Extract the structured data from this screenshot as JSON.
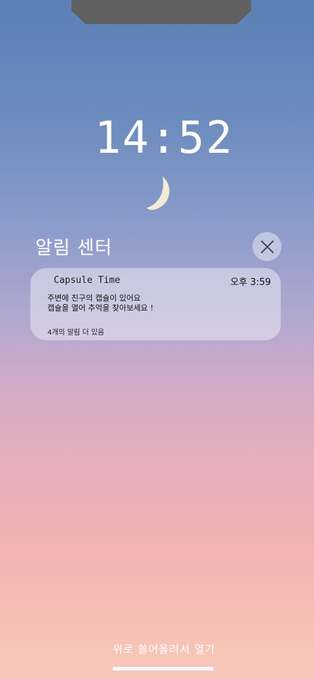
{
  "lockscreen": {
    "time": "14:52",
    "moon_icon": "crescent-moon-icon"
  },
  "notification_center": {
    "title": "알림 센터",
    "close_icon": "close-icon"
  },
  "notification": {
    "app_name": "Capsule Time",
    "time": "오후 3:59",
    "line1": "주변에 친구의 캡슐이 있어요",
    "line2": "캡슐을 열어 추억을 찾아보세요 !",
    "more": "4개의 알림 더 있음"
  },
  "footer": {
    "swipe_hint": "위로 쓸어올려서 열기"
  },
  "colors": {
    "sky_top": "#5b80b6",
    "sky_bottom": "#f8c8bb",
    "moon": "#f4ebd6",
    "card": "#ebebf5"
  }
}
